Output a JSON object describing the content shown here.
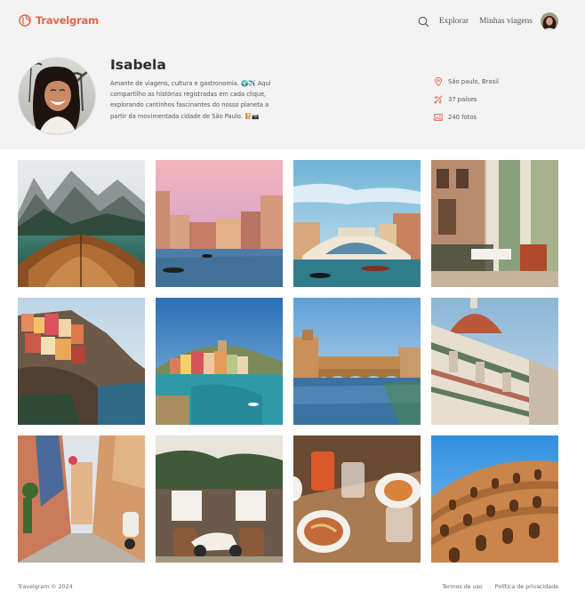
{
  "brand": {
    "name": "Travelgram",
    "color": "#e5654a"
  },
  "nav": {
    "search_icon": "search-icon",
    "links": [
      {
        "label": "Explorar"
      },
      {
        "label": "Minhas viagens"
      }
    ]
  },
  "profile": {
    "name": "Isabela",
    "bio": "Amante de viagens, cultura e gastronomia. 🌍✈️ Aqui compartilho as histórias registradas em cada clique, explorando cantinhos fascinantes do nosso planeta a partir da movimentada cidade de São Paulo. 📔📷",
    "stats": {
      "location": "São paulo, Brasil",
      "countries": "37 países",
      "photos": "240 fotos"
    }
  },
  "gallery": [
    "lake-boat",
    "venice-canal",
    "rialto-bridge",
    "venice-cafe",
    "manarola",
    "vernazza",
    "ponte-vecchio",
    "florence-duomo",
    "italian-alley",
    "vespa-shop",
    "spritz-dinner",
    "colosseum"
  ],
  "footer": {
    "copyright": "Travelgram © 2024",
    "terms": "Termos de uso",
    "privacy": "Política de privacidade"
  }
}
